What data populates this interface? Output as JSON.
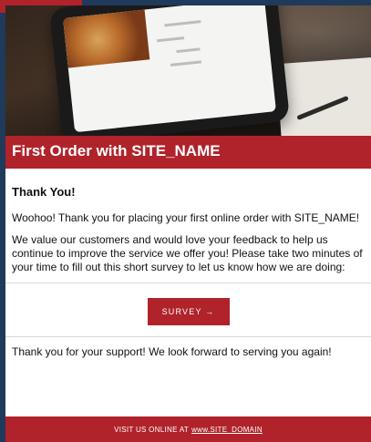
{
  "email": {
    "title": "First Order with SITE_NAME",
    "heading": "Thank You!",
    "paragraph1": "Woohoo! Thank you for placing your first online order with SITE_NAME!",
    "paragraph2": "We value our customers and would love your feedback to help us continue to improve the service we offer you! Please take two minutes of your time to fill out this short survey to let us know how we are doing:",
    "survey_button": "SURVEY →",
    "closing": "Thank you for your support! We look forward to serving you again!",
    "footer_prefix": "VISIT US ONLINE AT",
    "footer_link": "www.SITE_DOMAIN"
  },
  "colors": {
    "brand_red": "#b0232a",
    "page_background": "#1f3a5a",
    "text": "#111111"
  },
  "hero_image": {
    "subject": "tablet showing a restaurant menu on a wooden table"
  }
}
